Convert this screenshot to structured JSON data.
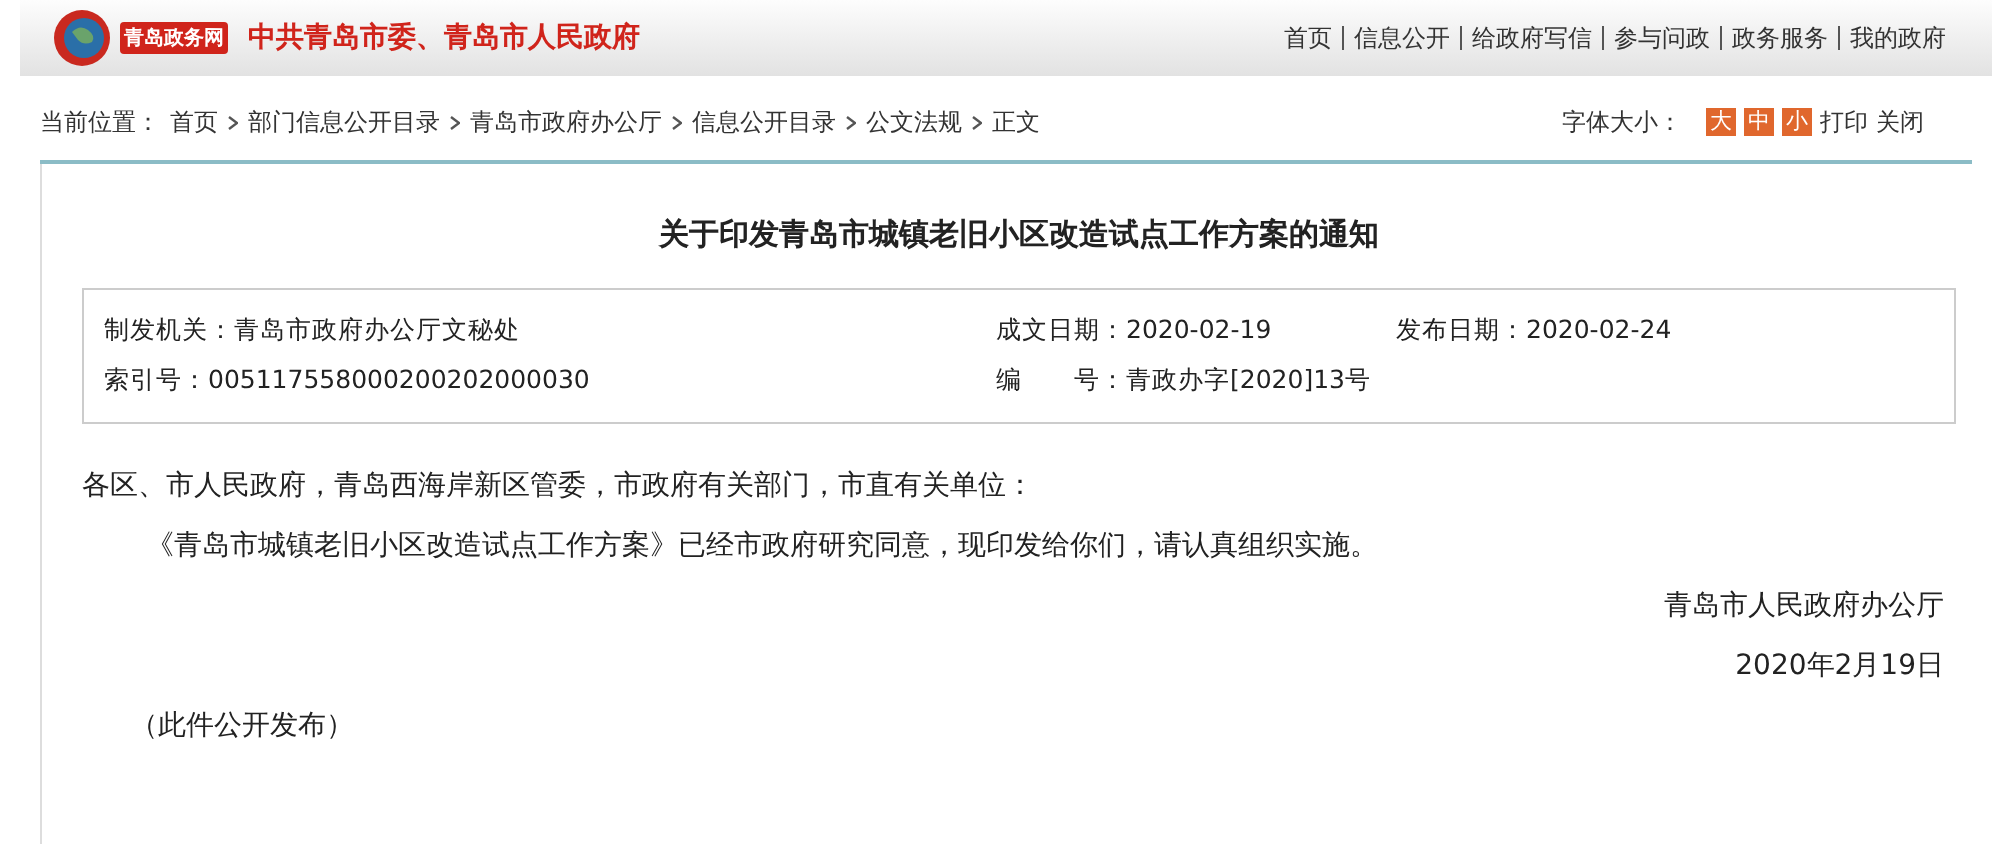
{
  "header": {
    "logo_text": "青岛政务网",
    "site_title": "中共青岛市委、青岛市人民政府",
    "nav": [
      "首页",
      "信息公开",
      "给政府写信",
      "参与问政",
      "政务服务",
      "我的政府"
    ]
  },
  "breadcrumb": {
    "label": "当前位置：",
    "items": [
      "首页",
      "部门信息公开目录",
      "青岛市政府办公厅",
      "信息公开目录",
      "公文法规",
      "正文"
    ]
  },
  "tools": {
    "label": "字体大小：",
    "sizes": [
      "大",
      "中",
      "小"
    ],
    "links": [
      "打印",
      "关闭"
    ]
  },
  "article": {
    "title": "关于印发青岛市城镇老旧小区改造试点工作方案的通知",
    "meta": [
      {
        "label": "制发机关：",
        "value": "青岛市政府办公厅文秘处"
      },
      {
        "label": "成文日期：",
        "value": "2020-02-19"
      },
      {
        "label": "发布日期：",
        "value": "2020-02-24"
      },
      {
        "label": "索引号：",
        "value": "005117558000200202000030"
      },
      {
        "label": "编　　号：",
        "value": "青政办字[2020]13号"
      }
    ],
    "body": [
      {
        "kind": "salutation",
        "text": "各区、市人民政府，青岛西海岸新区管委，市政府有关部门，市直有关单位："
      },
      {
        "kind": "paragraph",
        "text": "《青岛市城镇老旧小区改造试点工作方案》已经市政府研究同意，现印发给你们，请认真组织实施。"
      },
      {
        "kind": "signature",
        "text": "青岛市人民政府办公厅"
      },
      {
        "kind": "signature",
        "text": "2020年2月19日"
      },
      {
        "kind": "note",
        "text": "（此件公开发布）"
      }
    ]
  }
}
